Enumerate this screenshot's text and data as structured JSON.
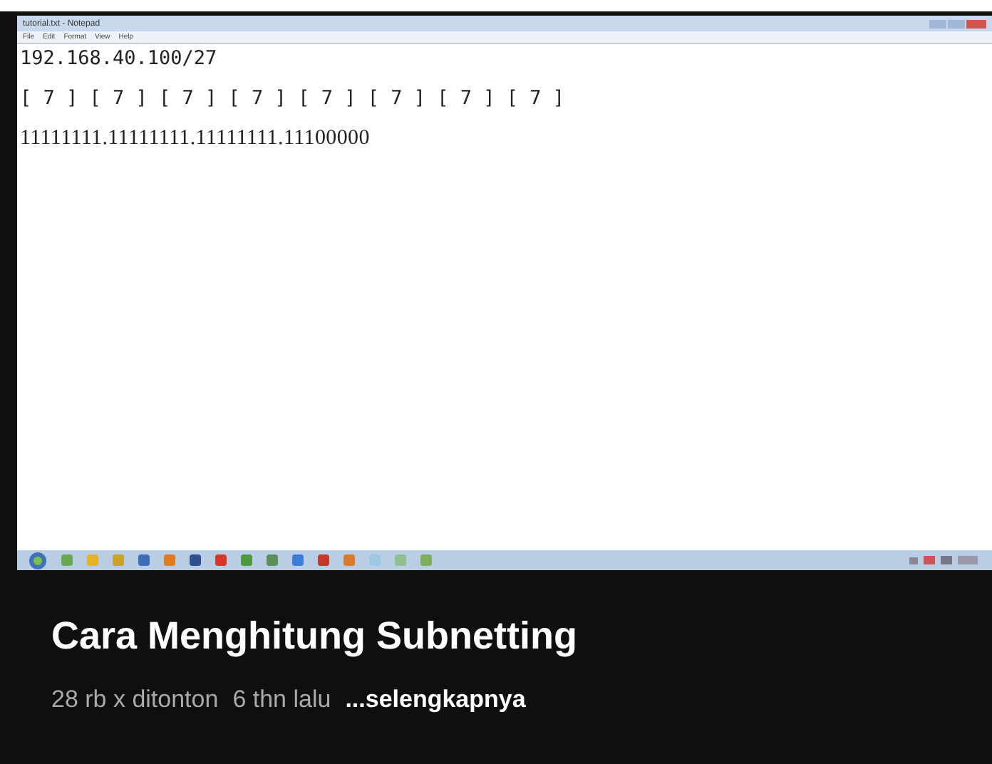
{
  "video_frame": {
    "window": {
      "title": "tutorial.txt - Notepad"
    },
    "menu": [
      "File",
      "Edit",
      "Format",
      "View",
      "Help"
    ],
    "lines": [
      {
        "kind": "mono",
        "text": "192.168.40.100/27"
      },
      {
        "kind": "mono",
        "text": "[ 7 ] [ 7 ] [ 7 ] [ 7 ] [ 7 ] [ 7 ] [ 7 ] [ 7 ]"
      },
      {
        "kind": "serif",
        "text": "11111111.11111111.11111111.11100000"
      }
    ]
  },
  "video": {
    "title": "Cara Menghitung Subnetting",
    "views": "28 rb x ditonton",
    "age": "6 thn lalu",
    "more": "...selengkapnya"
  }
}
